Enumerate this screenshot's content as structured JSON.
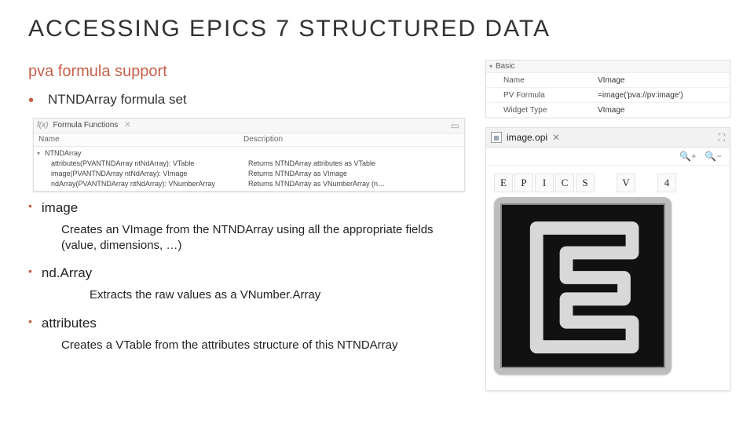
{
  "title": "ACCESSING EPICS 7 STRUCTURED DATA",
  "subtitle": "pva formula support",
  "bullets": {
    "main": "NTNDArray formula set",
    "items": [
      {
        "name": "image",
        "desc": "Creates an VImage from the NTNDArray using all the appropriate fields (value, dimensions, …)"
      },
      {
        "name": "nd.Array",
        "desc": "Extracts the raw values as a VNumber.Array"
      },
      {
        "name": "attributes",
        "desc": "Creates a VTable from the attributes structure of this NTNDArray"
      }
    ]
  },
  "formula_panel": {
    "tab": "Formula Functions",
    "columns": {
      "name": "Name",
      "desc": "Description"
    },
    "group": "NTNDArray",
    "rows": [
      {
        "sig": "attributes(PVANTNDArray ntNdArray): VTable",
        "ret": "Returns NTNDArray attributes as VTable"
      },
      {
        "sig": "image(PVANTNDArray ntNdArray): VImage",
        "ret": "Returns NTNDArray as VImage"
      },
      {
        "sig": "ndArray(PVANTNDArray ntNdArray): VNumberArray",
        "ret": "Returns NTNDArray as VNumberArray (n…"
      }
    ]
  },
  "properties": {
    "section": "Basic",
    "rows": [
      {
        "k": "Name",
        "v": "VImage"
      },
      {
        "k": "PV Formula",
        "v": "=image('pva://pv:image')"
      },
      {
        "k": "Widget Type",
        "v": "VImage"
      }
    ]
  },
  "opi": {
    "tab": "image.opi",
    "tiles": [
      "E",
      "P",
      "I",
      "C",
      "S",
      " ",
      "V",
      " ",
      "4"
    ]
  }
}
